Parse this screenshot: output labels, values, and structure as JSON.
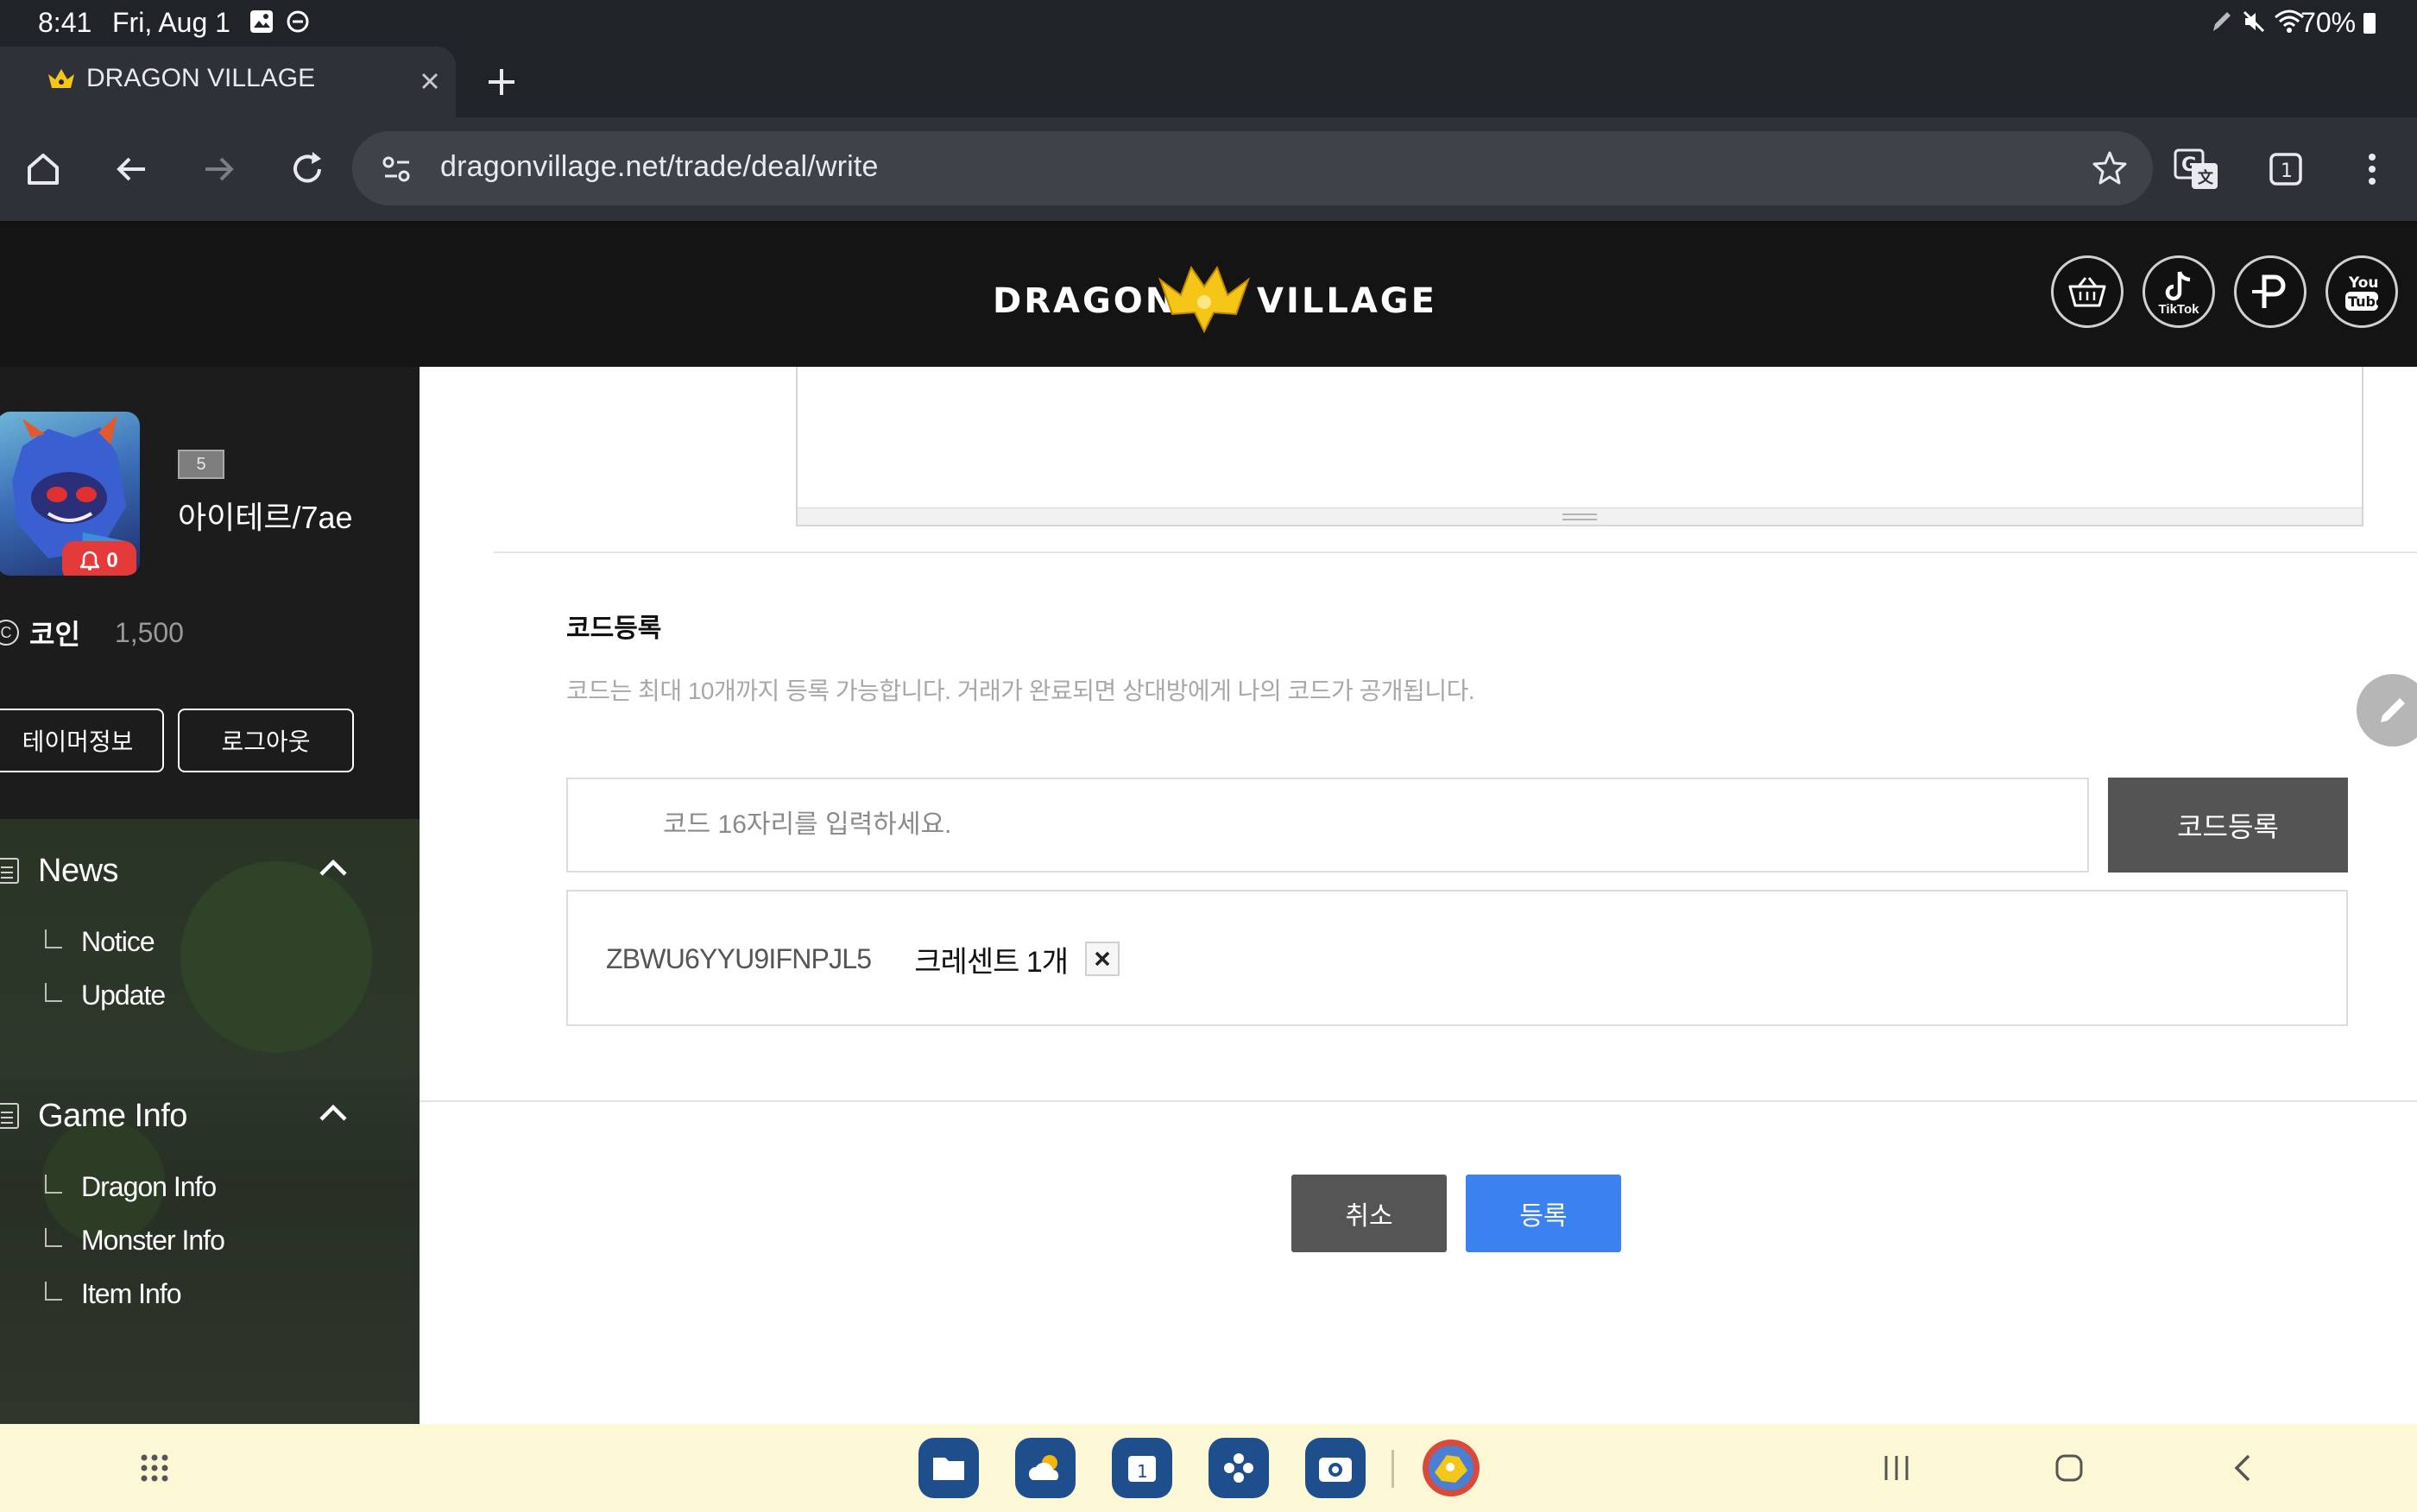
{
  "status_bar": {
    "time": "8:41",
    "date": "Fri, Aug 1",
    "battery": "70%"
  },
  "browser": {
    "tab_title": "DRAGON VILLAGE",
    "url": "dragonvillage.net/trade/deal/write",
    "tab_count": "1"
  },
  "site": {
    "logo_left": "DRAGON",
    "logo_right": "VILLAGE",
    "social": [
      {
        "name": "shop",
        "label": ""
      },
      {
        "name": "tiktok",
        "label": "TikTok"
      },
      {
        "name": "p",
        "label": ""
      },
      {
        "name": "youtube",
        "label": "You Tube"
      }
    ]
  },
  "sidebar": {
    "level": "5",
    "username": "아이테르/7ae",
    "notification_count": "0",
    "coin_label": "코인",
    "coin_value": "1,500",
    "tamer_info_btn": "테이머정보",
    "logout_btn": "로그아웃",
    "menu": [
      {
        "label": "News",
        "items": [
          "Notice",
          "Update"
        ]
      },
      {
        "label": "Game Info",
        "items": [
          "Dragon Info",
          "Monster Info",
          "Item Info"
        ]
      }
    ]
  },
  "code_section": {
    "title": "코드등록",
    "description": "코드는 최대 10개까지 등록 가능합니다. 거래가 완료되면 상대방에게 나의 코드가 공개됩니다.",
    "input_placeholder": "코드 16자리를 입력하세요.",
    "register_button": "코드등록",
    "codes": [
      {
        "code": "ZBWU6YYU9IFNPJL5",
        "product": "크레센트 1개"
      }
    ]
  },
  "actions": {
    "cancel": "취소",
    "submit": "등록"
  },
  "colors": {
    "submit_blue": "#3b82f0",
    "register_gray": "#545454",
    "logo_gold": "#f5c518",
    "alert_red": "#e53a3a"
  }
}
